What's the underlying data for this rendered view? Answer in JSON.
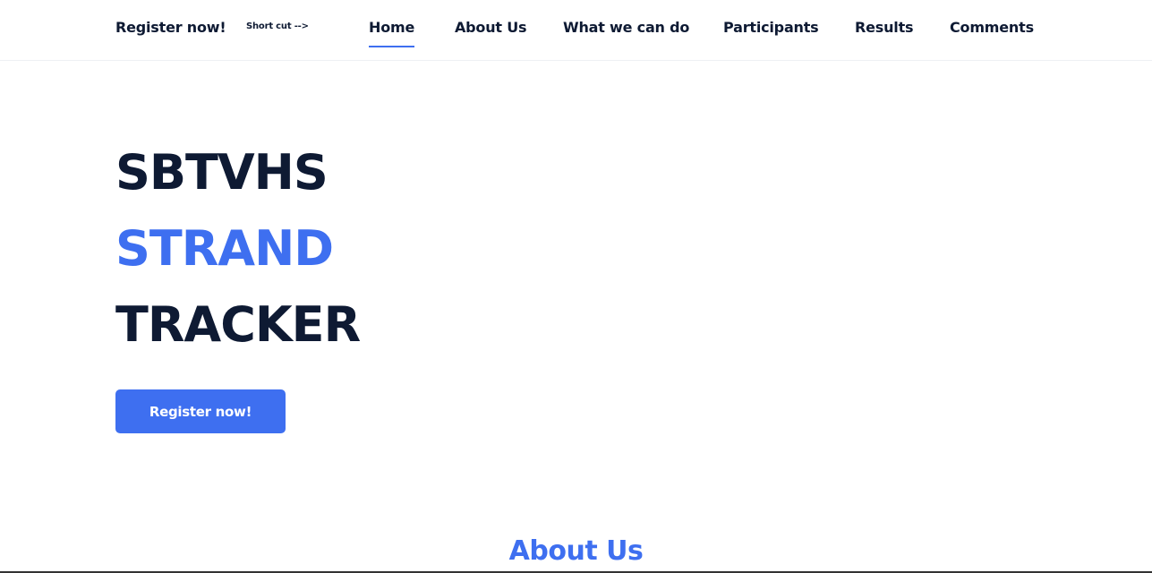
{
  "header": {
    "register_label": "Register now!",
    "shortcut_label": "Short cut -->",
    "nav": [
      {
        "label": "Home",
        "active": true
      },
      {
        "label": "About Us",
        "active": false
      },
      {
        "label": "What we can do",
        "active": false
      },
      {
        "label": "Participants",
        "active": false
      },
      {
        "label": "Results",
        "active": false
      },
      {
        "label": "Comments",
        "active": false
      }
    ]
  },
  "hero": {
    "line1": "SBTVHS",
    "line2": "STRAND",
    "line3": "TRACKER",
    "cta_label": "Register now!"
  },
  "about": {
    "title": "About Us"
  },
  "colors": {
    "accent": "#3e6ff0",
    "text": "#0e1a33"
  }
}
